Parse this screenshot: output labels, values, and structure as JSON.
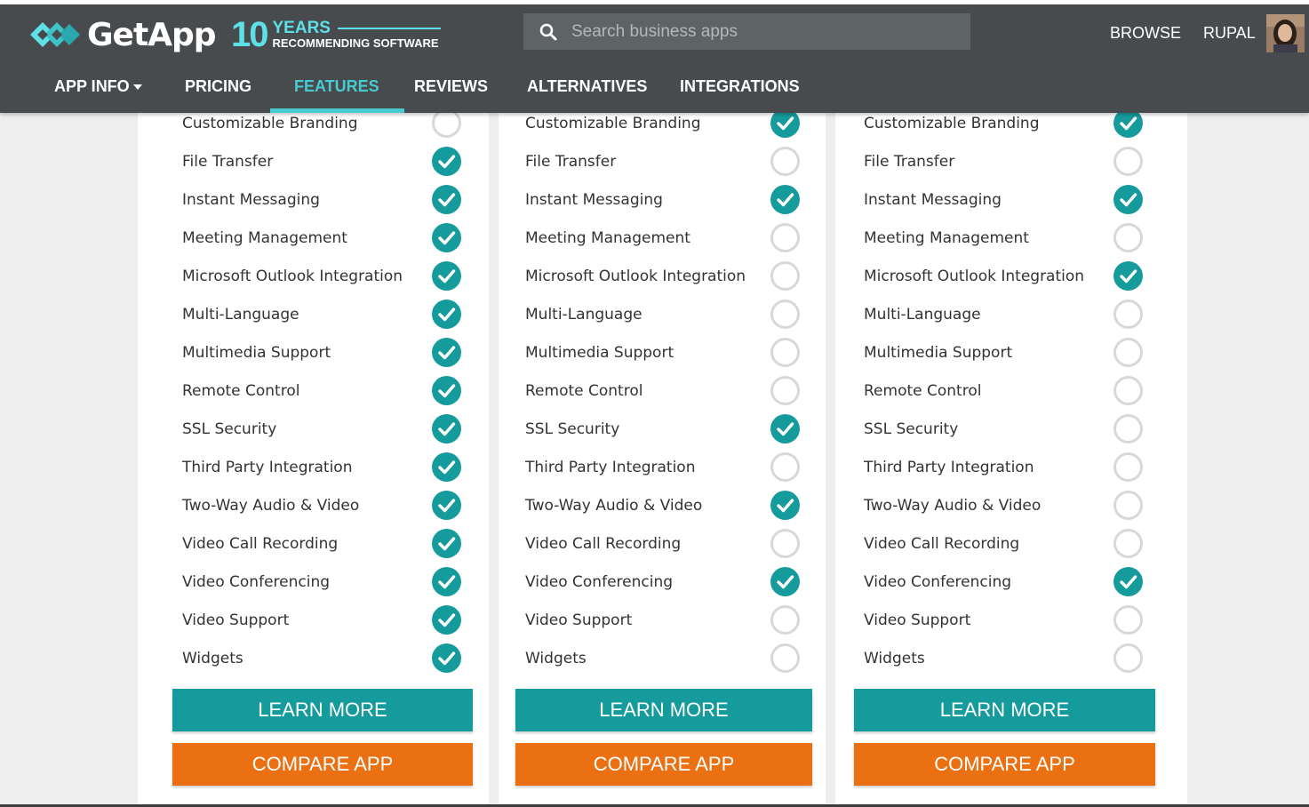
{
  "brand": {
    "logo_text": "GetApp",
    "badge_number": "10",
    "badge_years": "YEARS",
    "badge_subtitle": "RECOMMENDING SOFTWARE",
    "accent_color": "#47cbd0"
  },
  "search": {
    "placeholder": "Search business apps"
  },
  "header_links": {
    "browse": "BROWSE",
    "user": "RUPAL"
  },
  "tabs": [
    {
      "label": "APP INFO",
      "active": false,
      "has_dropdown": true
    },
    {
      "label": "PRICING",
      "active": false
    },
    {
      "label": "FEATURES",
      "active": true
    },
    {
      "label": "REVIEWS",
      "active": false
    },
    {
      "label": "ALTERNATIVES",
      "active": false
    },
    {
      "label": "INTEGRATIONS",
      "active": false
    }
  ],
  "features": [
    "Customizable Branding",
    "File Transfer",
    "Instant Messaging",
    "Meeting Management",
    "Microsoft Outlook Integration",
    "Multi-Language",
    "Multimedia Support",
    "Remote Control",
    "SSL Security",
    "Third Party Integration",
    "Two-Way Audio & Video",
    "Video Call Recording",
    "Video Conferencing",
    "Video Support",
    "Widgets"
  ],
  "columns": [
    {
      "checks": [
        false,
        true,
        true,
        true,
        true,
        true,
        true,
        true,
        true,
        true,
        true,
        true,
        true,
        true,
        true
      ]
    },
    {
      "checks": [
        true,
        false,
        true,
        false,
        false,
        false,
        false,
        false,
        true,
        false,
        true,
        false,
        true,
        false,
        false
      ]
    },
    {
      "checks": [
        true,
        false,
        true,
        false,
        true,
        false,
        false,
        false,
        false,
        false,
        false,
        false,
        true,
        false,
        false
      ]
    }
  ],
  "buttons": {
    "learn_more": "LEARN MORE",
    "compare_app": "COMPARE APP"
  },
  "colors": {
    "check_on": "#169b9d",
    "check_off": "#d8d8d8",
    "learn_button": "#169b9d",
    "compare_button": "#ea7011",
    "nav_bg": "#474b4e"
  }
}
